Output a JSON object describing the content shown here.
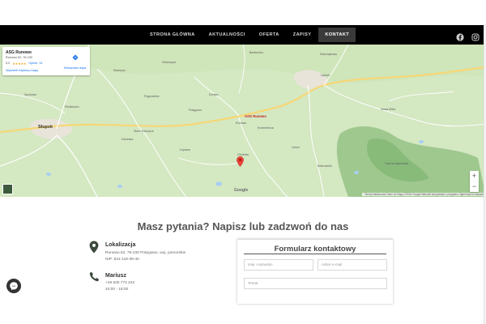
{
  "nav": {
    "items": [
      "STRONA GŁÓWNA",
      "AKTUALNOŚCI",
      "OFERTA",
      "ZAPISY",
      "KONTAKT"
    ],
    "active_index": 4,
    "social_icons": [
      "facebook-icon",
      "instagram-icon"
    ]
  },
  "map": {
    "place_title": "ASG Runowo",
    "place_address": "Runowo 62, 76-230",
    "rating": "5,0",
    "stars": "★★★★★",
    "reviews": "Opinie: 31",
    "directions_label": "Wskazówki dojaz.",
    "larger_map_link": "Wyświetl większą mapę",
    "pin_label": "ASG Runowo",
    "zoom_in": "+",
    "zoom_out": "−",
    "google_logo": "Google",
    "attribution": "Skróty klawiszowe   Dane do Mapy ©2024 Google   Warunki korzystania z programu   Zgłoś błąd w mapach",
    "labels": {
      "slupsk": "Słupsk",
      "barlomino": "Bartlomino",
      "dzieciatkowo": "Dzieciątkowo",
      "pogorzelice": "Pogorzelice",
      "potegowo": "Potęgowo",
      "skarszyn": "Skarszyn",
      "damnica": "Damnica",
      "glodowo": "Głodowo",
      "lebork": "Lębork",
      "krzemienica": "Krzemienica",
      "lesno": "Leśno",
      "runowo": "Runowo",
      "dretwo": "Dretwo",
      "bobrowniki": "Bobrowniki",
      "lulemino": "Łupawa",
      "stare_dobrzyce": "Stare Dobrzyce",
      "sycewice": "Sycewice",
      "redzikowo": "Redzikowo",
      "glowczyce": "Główczyce",
      "nowa_wies": "Nowa Wieś",
      "czarne": "Czarna Dąbrówka"
    }
  },
  "contact": {
    "heading": "Masz pytania? Napisz lub zadzwoń do nas",
    "location_title": "Lokalizacja",
    "location_address": "Runowo 62, 76-230 Potęgowo, woj. pomorskie",
    "location_nip": "NIP: 841-118-39-40",
    "phone_title": "Mariusz",
    "phone_number": "+48 530 774 242",
    "phone_hours": "10:00 - 18:00"
  },
  "form": {
    "title": "Formularz kontaktowy",
    "name_placeholder": "Imię i nazwisko",
    "email_placeholder": "Adres e-mail",
    "subject_placeholder": "Temat"
  },
  "colors": {
    "nav_bg": "#000000",
    "map_green": "#d3e6c0",
    "pin_red": "#ea4335",
    "accent_dark": "#333333"
  }
}
